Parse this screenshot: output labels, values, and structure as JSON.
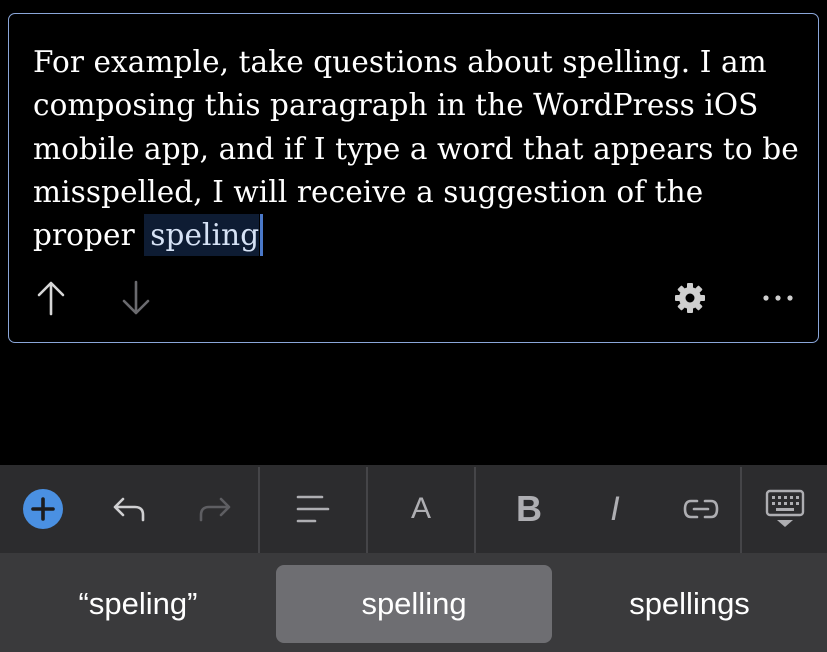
{
  "editor": {
    "paragraph_text": "For example, take questions about spelling. I am composing this paragraph in the WordPress iOS mobile app, and if I type a word that appears to be misspelled, I will receive a suggestion of the proper ",
    "selected_word": "speling",
    "block_toolbar": {
      "move_up_icon": "arrow-up-icon",
      "move_down_icon": "arrow-down-icon",
      "settings_icon": "gear-icon",
      "more_icon": "ellipsis-icon"
    }
  },
  "format_toolbar": {
    "add_block_icon": "plus-circle-icon",
    "undo_icon": "undo-icon",
    "redo_icon": "redo-icon",
    "align_icon": "align-left-icon",
    "text_color_label": "A",
    "bold_label": "B",
    "italic_label": "I",
    "link_icon": "link-icon",
    "hide_keyboard_icon": "keyboard-dismiss-icon"
  },
  "suggestions": [
    {
      "label": "“speling”",
      "selected": false
    },
    {
      "label": "spelling",
      "selected": true
    },
    {
      "label": "spellings",
      "selected": false
    }
  ],
  "colors": {
    "accent": "#4a90e2",
    "block_border": "#8aa6d9",
    "toolbar_bg": "#2c2c2e",
    "suggestion_bg": "#3a3a3c",
    "suggestion_active_bg": "#6e6e72"
  }
}
